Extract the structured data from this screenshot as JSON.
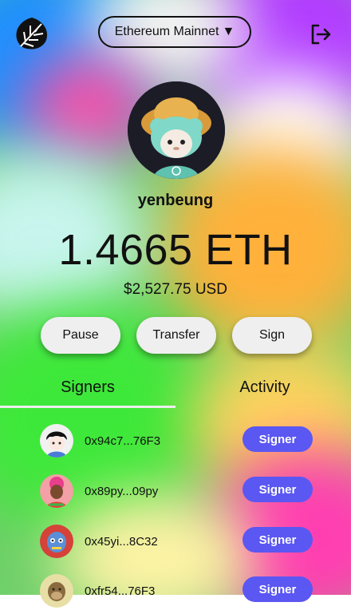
{
  "header": {
    "network_label": "Ethereum Mainnet",
    "network_caret": "▼",
    "logo_icon": "leaf-logo-icon",
    "logout_icon": "logout-icon"
  },
  "profile": {
    "username": "yenbeung",
    "avatar_icon": "sheep-avatar"
  },
  "wallet": {
    "balance": "1.4665 ETH",
    "usd": "$2,527.75 USD"
  },
  "actions": {
    "pause": "Pause",
    "transfer": "Transfer",
    "sign": "Sign"
  },
  "tabs": {
    "signers": "Signers",
    "activity": "Activity",
    "active": "signers"
  },
  "signers": [
    {
      "address": "0x94c7...76F3",
      "badge": "Signer"
    },
    {
      "address": "0x89py...09py",
      "badge": "Signer"
    },
    {
      "address": "0x45yi...8C32",
      "badge": "Signer"
    },
    {
      "address": "0xfr54...76F3",
      "badge": "Signer"
    }
  ],
  "colors": {
    "accent": "#5b57f2",
    "button_bg": "#efefef",
    "text": "#111111"
  }
}
